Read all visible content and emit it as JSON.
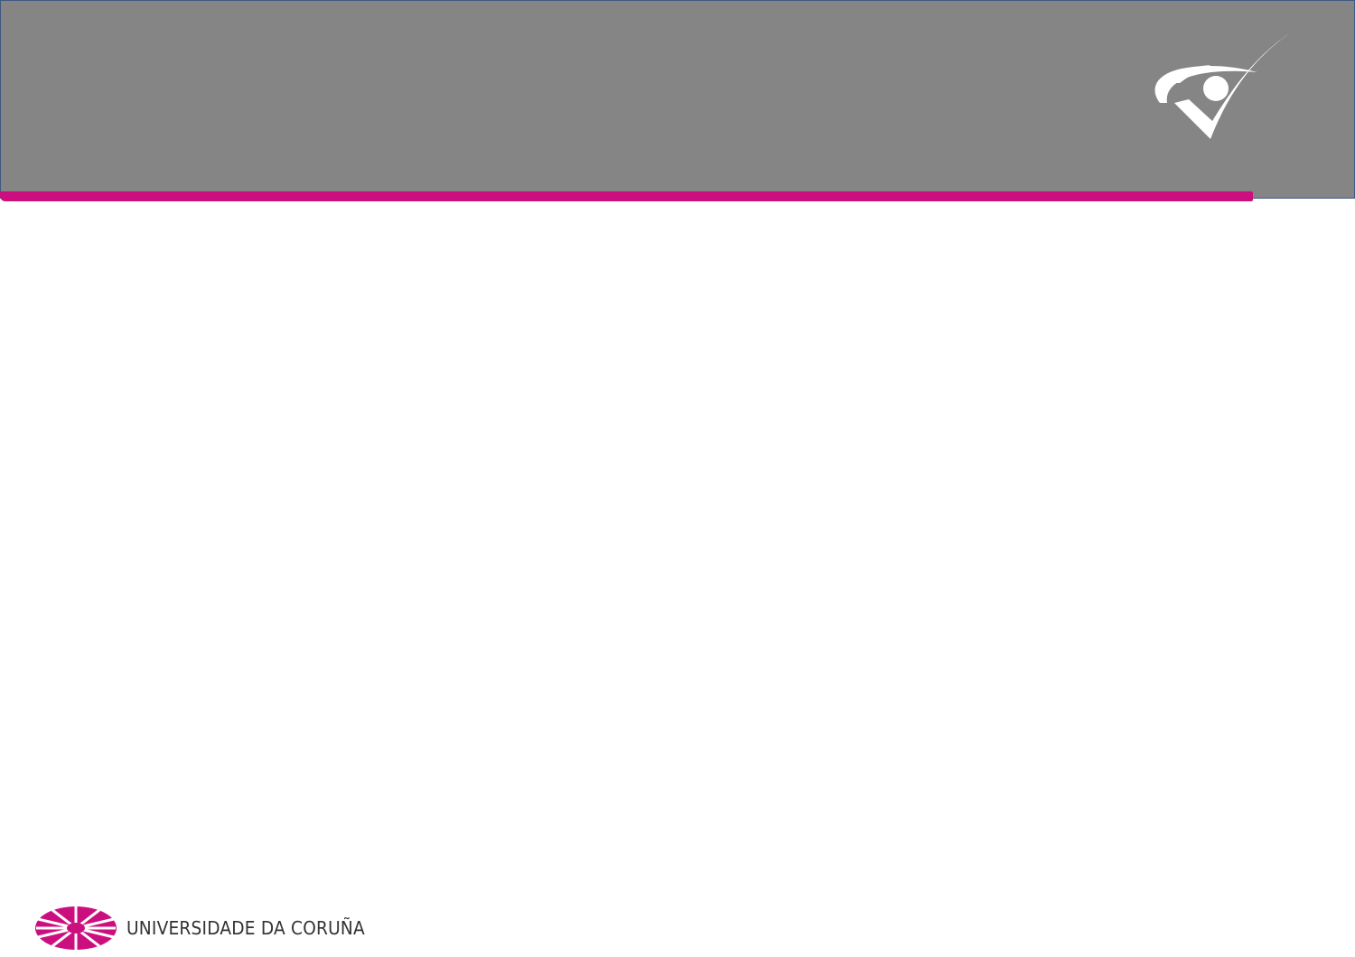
{
  "colors": {
    "header_background": "#858585",
    "accent": "#cc0f7f",
    "page_background": "#ffffff",
    "footer_text": "#333333"
  },
  "header": {
    "logo_icon": "eye-check-icon"
  },
  "footer": {
    "emblem_icon": "university-emblem-icon",
    "institution_name": "UNIVERSIDADE DA CORUÑA"
  }
}
